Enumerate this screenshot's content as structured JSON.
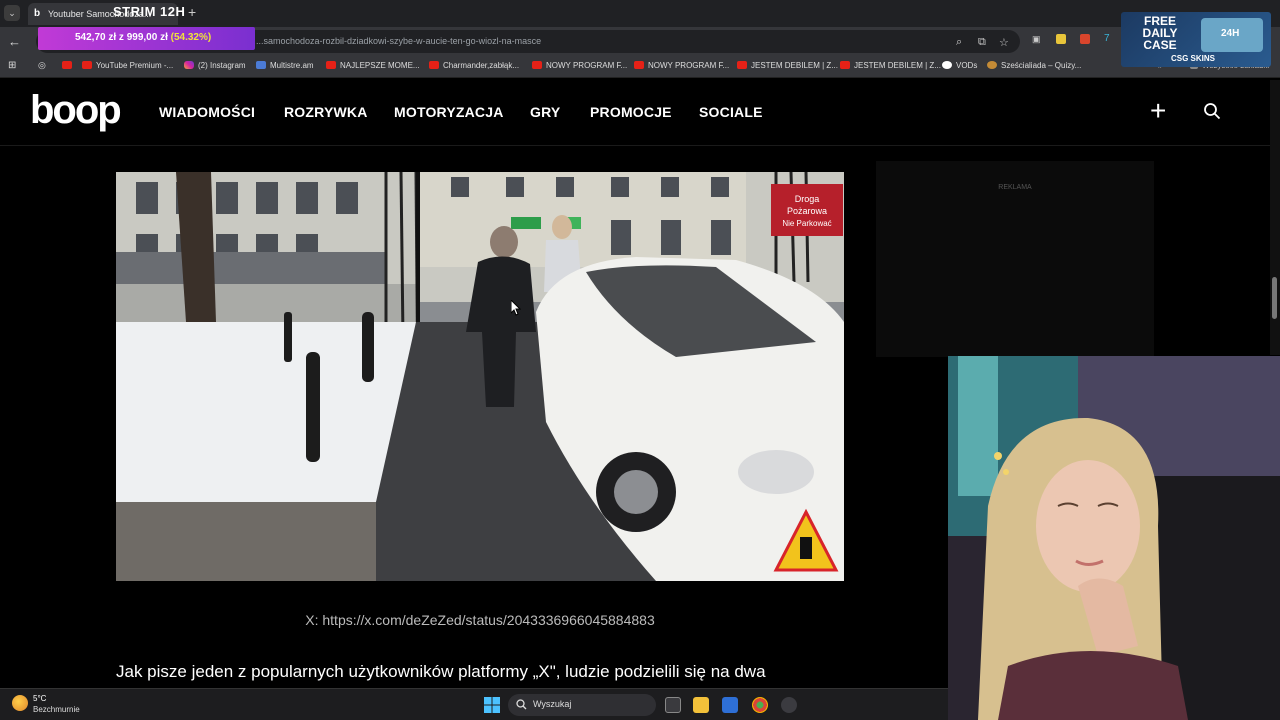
{
  "browser": {
    "tab_title": "Youtuber Samochodoza...",
    "tab_favicon": "b",
    "url": "...samochodoza-rozbil-dziadkowi-szybe-w-aucie-ten-go-wiozl-na-masce",
    "bookmarks": [
      {
        "label": "YouTube Premium -...",
        "icon": "youtube-icon"
      },
      {
        "label": "(2) Instagram",
        "icon": "instagram-icon"
      },
      {
        "label": "Multistre.am",
        "icon": "multistream-icon"
      },
      {
        "label": "NAJLEPSZE MOME...",
        "icon": "youtube-icon"
      },
      {
        "label": "Charmander,zabłąk...",
        "icon": "youtube-icon"
      },
      {
        "label": "NOWY PROGRAM F...",
        "icon": "youtube-icon"
      },
      {
        "label": "NOWY PROGRAM F...",
        "icon": "youtube-icon"
      },
      {
        "label": "JESTEM DEBILEM | Z...",
        "icon": "youtube-icon"
      },
      {
        "label": "JESTEM DEBILEM | Z...",
        "icon": "youtube-icon"
      },
      {
        "label": "VODs",
        "icon": "globe-icon"
      },
      {
        "label": "Sześcialiada – Quizy...",
        "icon": "plus-icon"
      }
    ],
    "all_bookmarks_label": "Wszystkie zakładki"
  },
  "stream_overlay": {
    "title": "STRIM 12H",
    "donation_amount": "542,70 zł z 999,00 zł",
    "donation_percent": "(54.32%)",
    "donation_progress": 0.5432,
    "ad_free": "FREE DAILY CASE",
    "ad_brand": "CSG SKINS",
    "ad_badge": "24H"
  },
  "site": {
    "logo": "boop",
    "nav": [
      "WIADOMOŚCI",
      "ROZRYWKA",
      "MOTORYZACJA",
      "GRY",
      "PROMOCJE",
      "SOCIALE"
    ]
  },
  "article": {
    "image_sign_line1": "Droga",
    "image_sign_line2": "Pożarowa",
    "image_sign_line3": "Nie Parkować",
    "caption": "X: https://x.com/deZeZed/status/2043336966045884883",
    "body": "Jak pisze jeden z popularnych użytkowników platformy „X\", ludzie podzielili się na dwa"
  },
  "sidebar": {
    "ad_label": "REKLAMA"
  },
  "taskbar": {
    "temperature": "5°C",
    "weather": "Bezchmurnie",
    "search_placeholder": "Wyszukaj"
  }
}
